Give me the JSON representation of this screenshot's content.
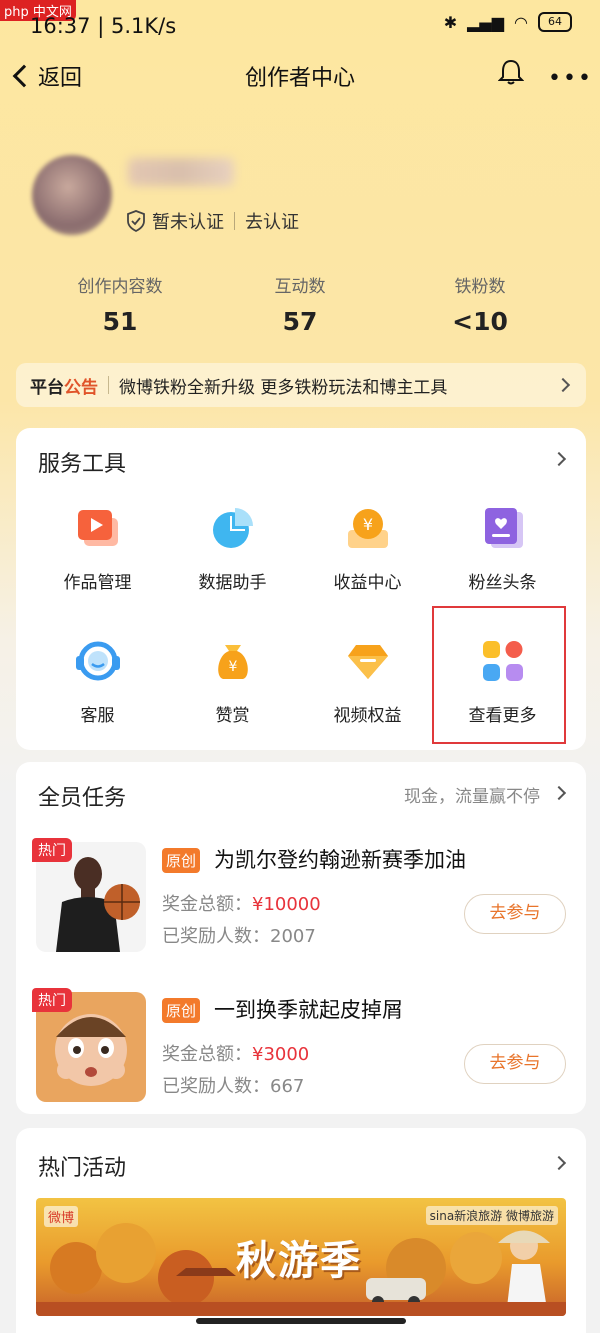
{
  "status": {
    "time": "16:37",
    "speed": "5.1K/s",
    "battery": "64",
    "watermark": "php 中文网"
  },
  "nav": {
    "back_label": "返回",
    "title": "创作者中心"
  },
  "profile": {
    "verify_status": "暂未认证",
    "verify_action": "去认证"
  },
  "stats": [
    {
      "label": "创作内容数",
      "value": "51"
    },
    {
      "label": "互动数",
      "value": "57"
    },
    {
      "label": "铁粉数",
      "value": "<10"
    }
  ],
  "notice": {
    "tag_a": "平台",
    "tag_b": "公告",
    "text": "微博铁粉全新升级 更多铁粉玩法和博主工具"
  },
  "tools": {
    "title": "服务工具",
    "items": [
      {
        "label": "作品管理",
        "icon": "video-folder-icon"
      },
      {
        "label": "数据助手",
        "icon": "pie-chart-icon"
      },
      {
        "label": "收益中心",
        "icon": "yuan-coin-icon"
      },
      {
        "label": "粉丝头条",
        "icon": "heart-book-icon"
      },
      {
        "label": "客服",
        "icon": "headset-icon"
      },
      {
        "label": "赞赏",
        "icon": "money-bag-icon"
      },
      {
        "label": "视频权益",
        "icon": "diamond-icon"
      },
      {
        "label": "查看更多",
        "icon": "grid-dots-icon"
      }
    ]
  },
  "tasks": {
    "title": "全员任务",
    "subtitle": "现金，流量赢不停",
    "items": [
      {
        "hot": "热门",
        "badge": "原创",
        "title": "为凯尔登约翰逊新赛季加油",
        "prize_label": "奖金总额：",
        "prize": "¥10000",
        "count_label": "已奖励人数：",
        "count": "2007",
        "button": "去参与"
      },
      {
        "hot": "热门",
        "badge": "原创",
        "title": "一到换季就起皮掉屑",
        "prize_label": "奖金总额：",
        "prize": "¥3000",
        "count_label": "已奖励人数：",
        "count": "667",
        "button": "去参与"
      }
    ]
  },
  "activities": {
    "title": "热门活动",
    "banner_text": "秋游季",
    "banner_logo_left": "微博",
    "banner_logo_right": "sina新浪旅游 微博旅游"
  },
  "colors": {
    "accent": "#e8742b",
    "price": "#e8333b",
    "highlight_box": "#e0393b"
  }
}
